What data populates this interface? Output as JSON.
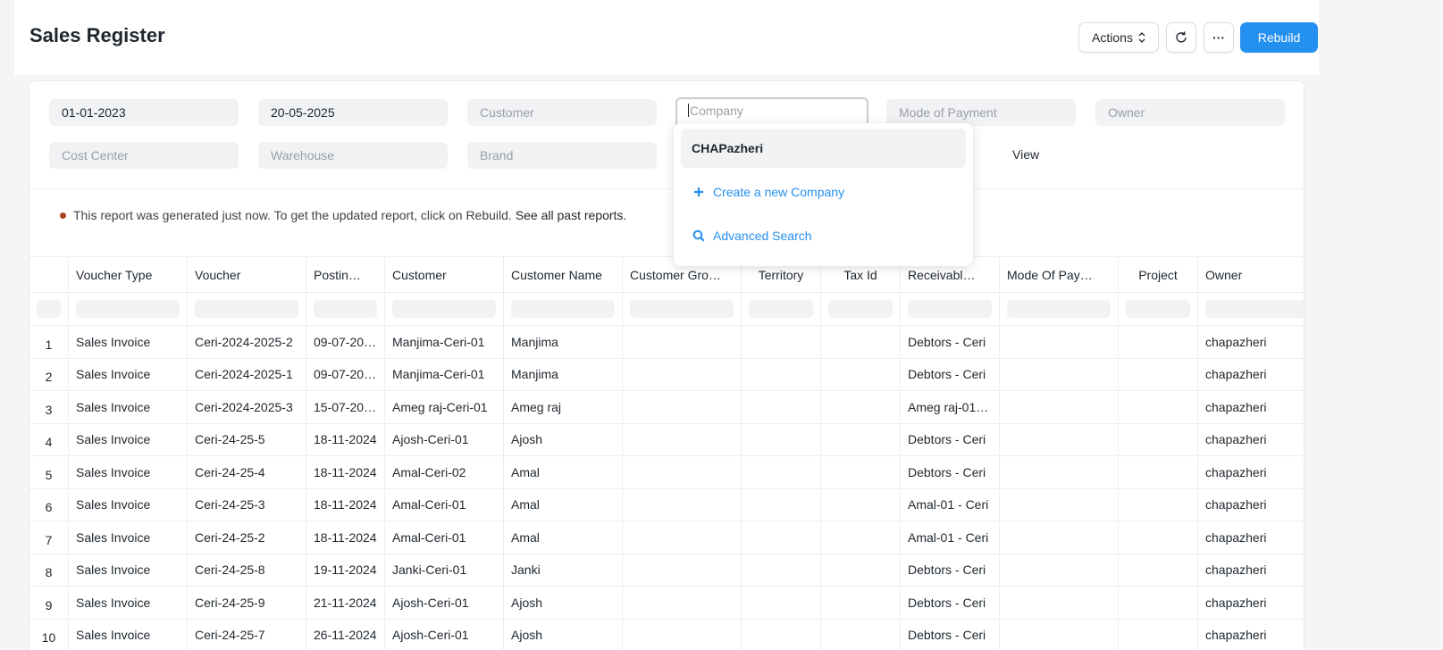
{
  "page": {
    "title": "Sales Register"
  },
  "toolbar": {
    "actions_label": "Actions",
    "actions_chevron": "⌃⌄",
    "refresh_icon": "refresh-icon",
    "more_label": "···",
    "rebuild_label": "Rebuild"
  },
  "filters": {
    "from_date": "01-01-2023",
    "to_date": "20-05-2025",
    "customer_placeholder": "Customer",
    "company_placeholder": "Company",
    "mode_of_payment_placeholder": "Mode of Payment",
    "owner_placeholder": "Owner",
    "cost_center_placeholder": "Cost Center",
    "warehouse_placeholder": "Warehouse",
    "brand_placeholder": "Brand",
    "view_label": "View"
  },
  "company_dropdown": {
    "items": [
      {
        "label": "CHAPazheri"
      },
      {
        "label": "Create a new Company",
        "icon": "plus-icon"
      },
      {
        "label": "Advanced Search",
        "icon": "search-icon"
      }
    ]
  },
  "notice": {
    "text": "This report was generated just now. To get the updated report, click on Rebuild.",
    "link": "See all past reports."
  },
  "table": {
    "columns": [
      "Voucher Type",
      "Voucher",
      "Postin…",
      "Customer",
      "Customer Name",
      "Customer Gro…",
      "Territory",
      "Tax Id",
      "Receivabl…",
      "Mode Of Pay…",
      "Project",
      "Owner"
    ],
    "rows": [
      {
        "idx": "1",
        "cells": [
          "Sales Invoice",
          "Ceri-2024-2025-2",
          "09-07-20…",
          "Manjima-Ceri-01",
          "Manjima",
          "",
          "",
          "",
          "Debtors - Ceri",
          "",
          "",
          "chapazheri"
        ]
      },
      {
        "idx": "2",
        "cells": [
          "Sales Invoice",
          "Ceri-2024-2025-1",
          "09-07-20…",
          "Manjima-Ceri-01",
          "Manjima",
          "",
          "",
          "",
          "Debtors - Ceri",
          "",
          "",
          "chapazheri"
        ]
      },
      {
        "idx": "3",
        "cells": [
          "Sales Invoice",
          "Ceri-2024-2025-3",
          "15-07-20…",
          "Ameg raj-Ceri-01",
          "Ameg raj",
          "",
          "",
          "",
          "Ameg raj-01…",
          "",
          "",
          "chapazheri"
        ]
      },
      {
        "idx": "4",
        "cells": [
          "Sales Invoice",
          "Ceri-24-25-5",
          "18-11-2024",
          "Ajosh-Ceri-01",
          "Ajosh",
          "",
          "",
          "",
          "Debtors - Ceri",
          "",
          "",
          "chapazheri"
        ]
      },
      {
        "idx": "5",
        "cells": [
          "Sales Invoice",
          "Ceri-24-25-4",
          "18-11-2024",
          "Amal-Ceri-02",
          "Amal",
          "",
          "",
          "",
          "Debtors - Ceri",
          "",
          "",
          "chapazheri"
        ]
      },
      {
        "idx": "6",
        "cells": [
          "Sales Invoice",
          "Ceri-24-25-3",
          "18-11-2024",
          "Amal-Ceri-01",
          "Amal",
          "",
          "",
          "",
          "Amal-01 - Ceri",
          "",
          "",
          "chapazheri"
        ]
      },
      {
        "idx": "7",
        "cells": [
          "Sales Invoice",
          "Ceri-24-25-2",
          "18-11-2024",
          "Amal-Ceri-01",
          "Amal",
          "",
          "",
          "",
          "Amal-01 - Ceri",
          "",
          "",
          "chapazheri"
        ]
      },
      {
        "idx": "8",
        "cells": [
          "Sales Invoice",
          "Ceri-24-25-8",
          "19-11-2024",
          "Janki-Ceri-01",
          "Janki",
          "",
          "",
          "",
          "Debtors - Ceri",
          "",
          "",
          "chapazheri"
        ]
      },
      {
        "idx": "9",
        "cells": [
          "Sales Invoice",
          "Ceri-24-25-9",
          "21-11-2024",
          "Ajosh-Ceri-01",
          "Ajosh",
          "",
          "",
          "",
          "Debtors - Ceri",
          "",
          "",
          "chapazheri"
        ]
      },
      {
        "idx": "10",
        "cells": [
          "Sales Invoice",
          "Ceri-24-25-7",
          "26-11-2024",
          "Ajosh-Ceri-01",
          "Ajosh",
          "",
          "",
          "",
          "Debtors - Ceri",
          "",
          "",
          "chapazheri"
        ]
      }
    ]
  },
  "colors": {
    "accent": "#2490ef",
    "notice_dot": "#a4421e"
  }
}
